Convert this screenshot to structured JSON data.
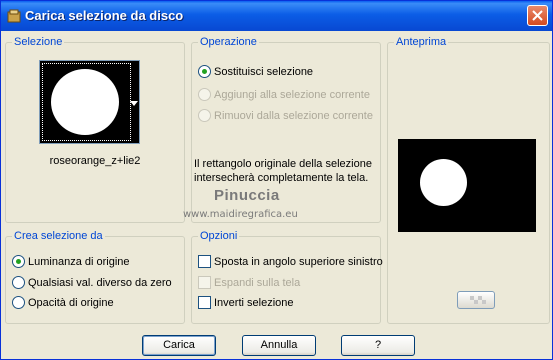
{
  "window": {
    "title": "Carica selezione da disco"
  },
  "selezione": {
    "legend": "Selezione",
    "file_name": "roseorange_z+lie2"
  },
  "operazione": {
    "legend": "Operazione",
    "options": [
      {
        "label": "Sostituisci selezione",
        "selected": true,
        "enabled": true
      },
      {
        "label": "Aggiungi alla selezione corrente",
        "selected": false,
        "enabled": false
      },
      {
        "label": "Rimuovi dalla selezione corrente",
        "selected": false,
        "enabled": false
      }
    ],
    "note_line1": "Il rettangolo originale della selezione",
    "note_line2": "intersecherà completamente la tela."
  },
  "anteprima": {
    "legend": "Anteprima"
  },
  "crea": {
    "legend": "Crea selezione da",
    "options": [
      {
        "label": "Luminanza di origine",
        "selected": true
      },
      {
        "label": "Qualsiasi val. diverso da zero",
        "selected": false
      },
      {
        "label": "Opacità di origine",
        "selected": false
      }
    ]
  },
  "opzioni": {
    "legend": "Opzioni",
    "options": [
      {
        "label": "Sposta in angolo superiore sinistro",
        "checked": false,
        "enabled": true
      },
      {
        "label": "Espandi sulla tela",
        "checked": false,
        "enabled": false
      },
      {
        "label": "Inverti selezione",
        "checked": false,
        "enabled": true
      }
    ]
  },
  "watermark": {
    "line1": "Pinuccia",
    "line2": "www.maidiregrafica.eu"
  },
  "buttons": {
    "carica": "Carica",
    "annulla": "Annulla",
    "help": "?"
  },
  "colors": {
    "title_bar": "#0b5de6",
    "legend_text": "#0046d5",
    "window_bg": "#ece9d8",
    "radio_dot": "#21a121"
  }
}
